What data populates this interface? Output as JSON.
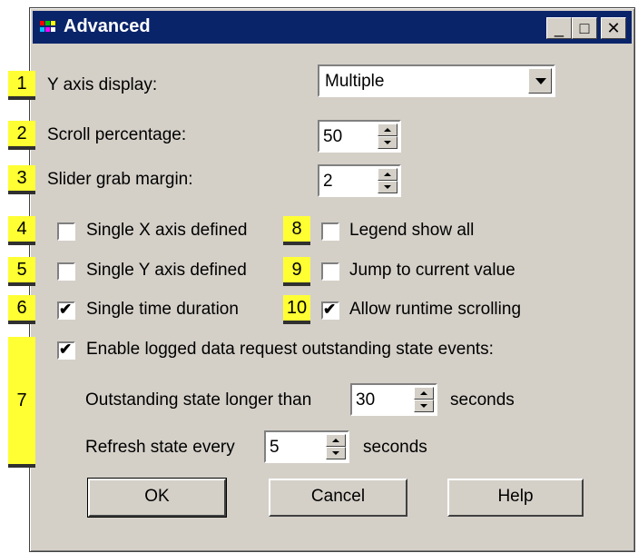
{
  "window": {
    "title": "Advanced",
    "minimize_glyph": "_",
    "maximize_glyph": "□",
    "close_glyph": "✕"
  },
  "badges": [
    "1",
    "2",
    "3",
    "4",
    "5",
    "6",
    "7",
    "8",
    "9",
    "10"
  ],
  "fields": {
    "y_axis_label": "Y axis display:",
    "y_axis_value": "Multiple",
    "scroll_label": "Scroll percentage:",
    "scroll_value": "50",
    "slider_label": "Slider grab margin:",
    "slider_value": "2"
  },
  "checkboxes": {
    "single_x": {
      "label": "Single X axis defined",
      "checked": false
    },
    "single_y": {
      "label": "Single Y axis defined",
      "checked": false
    },
    "single_time": {
      "label": "Single time duration",
      "checked": true
    },
    "legend_all": {
      "label": "Legend show all",
      "checked": false
    },
    "jump_current": {
      "label": "Jump to current value",
      "checked": false
    },
    "runtime_scroll": {
      "label": "Allow runtime scrolling",
      "checked": true
    },
    "logged_events": {
      "label": "Enable logged data request outstanding state events:",
      "checked": true
    }
  },
  "outstanding": {
    "label": "Outstanding state longer than",
    "value": "30",
    "unit": "seconds"
  },
  "refresh": {
    "label": "Refresh state every",
    "value": "5",
    "unit": "seconds"
  },
  "buttons": {
    "ok": "OK",
    "cancel": "Cancel",
    "help": "Help"
  },
  "check_mark": "✔",
  "colors": {
    "titlebar": "#0a246a",
    "dialog": "#d4d0c8",
    "badge": "#ffff33"
  }
}
